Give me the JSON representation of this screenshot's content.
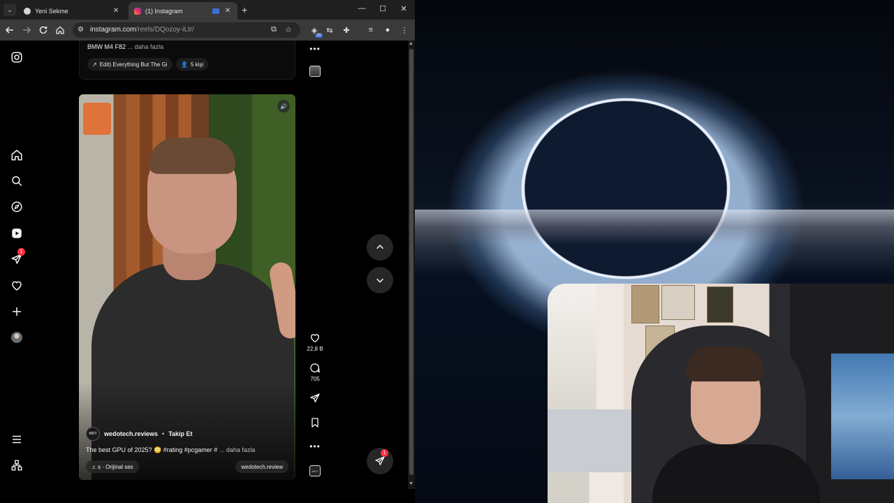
{
  "browser": {
    "tabs": [
      {
        "title": "Yeni Sekme",
        "active": false
      },
      {
        "title": "(1) Instagram",
        "active": true
      }
    ],
    "new_tab_icon": "plus-icon",
    "window_controls": [
      "minimize",
      "maximize",
      "close"
    ],
    "url_host": "instagram.com",
    "url_path": "/reels/DQozoy-iLtr/",
    "extension_badge": "20"
  },
  "sidebar": {
    "items": [
      {
        "name": "instagram-logo-icon"
      },
      {
        "name": "home-icon"
      },
      {
        "name": "search-icon"
      },
      {
        "name": "explore-icon"
      },
      {
        "name": "reels-icon"
      },
      {
        "name": "messages-icon",
        "badge": "1"
      },
      {
        "name": "notifications-icon"
      },
      {
        "name": "create-icon"
      },
      {
        "name": "profile-avatar"
      },
      {
        "name": "more-menu-icon"
      },
      {
        "name": "also-from-meta-icon"
      }
    ]
  },
  "prev_reel": {
    "caption": "BMW M4 F82",
    "more": "... daha fazla",
    "audio_chip": "Edit)  Everything But The Gi",
    "people_chip": "5 kişi"
  },
  "reel": {
    "author": "wedotech.reviews",
    "separator": "•",
    "follow": "Takip Et",
    "caption": "The best GPU of 2025? 😳 #rating #pcgamer #",
    "more": "... daha fazla",
    "audio": "s · Orijinal ses",
    "audio_tag": "wedotech.review",
    "avatar_text": "WDT"
  },
  "actions": {
    "likes": "22,8 B",
    "comments": "705"
  },
  "messages_badge": "1",
  "colors": {
    "accent_badge": "#ff3040",
    "chrome_tabbar": "#1f1f1f",
    "chrome_toolbar": "#3a3a3a"
  }
}
